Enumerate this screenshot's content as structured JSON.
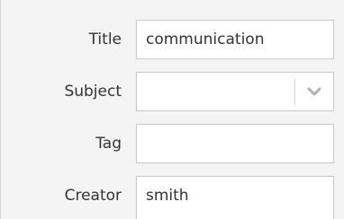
{
  "form": {
    "fields": [
      {
        "label": "Title",
        "value": "communication"
      },
      {
        "label": "Subject",
        "value": ""
      },
      {
        "label": "Tag",
        "value": ""
      },
      {
        "label": "Creator",
        "value": "smith"
      }
    ]
  },
  "icons": {
    "subject_dropdown": "chevron-down-icon"
  },
  "colors": {
    "background": "#f4f4f4",
    "field_border": "#c9c9c9",
    "chevron": "#b0b0b0"
  }
}
